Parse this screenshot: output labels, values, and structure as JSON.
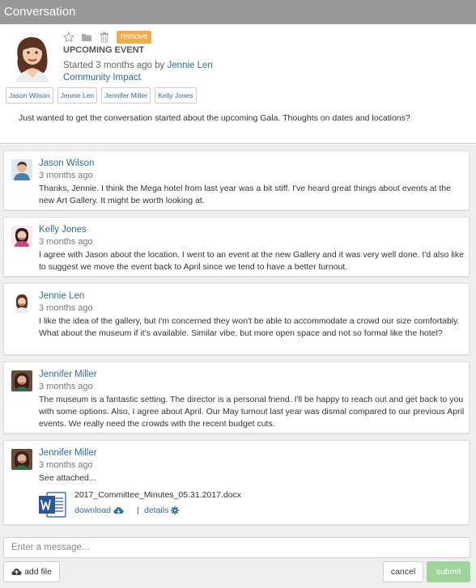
{
  "window": {
    "title": "Conversation"
  },
  "header": {
    "remove_label": "remove",
    "event_title": "UPCOMING EVENT",
    "started_text": "Started 3 months ago by",
    "started_by": "Jennie Len",
    "community": "Community Impact",
    "tags": [
      "Jason Wilson",
      "Jennie Len",
      "Jennifer Miller",
      "Kelly Jones"
    ],
    "intro": "Just wanted to get the conversation started about the upcoming Gala. Thoughts on dates and locations?"
  },
  "messages": [
    {
      "author": "Jason Wilson",
      "time": "3 months ago",
      "text": "Thanks, Jennie. I think the Mega hotel from last year was a bit stiff. I've heard great things about events at the new Art Gallery. It might be worth looking at."
    },
    {
      "author": "Kelly Jones",
      "time": "3 months ago",
      "text": "I agree with Jason about the location. I went to an event at the new Gallery and it was very well done. I'd also like to suggest we move the event back to April since we tend to have a better turnout."
    },
    {
      "author": "Jennie Len",
      "time": "3 months ago",
      "text": "I like the idea of the gallery, but I'm concerned they won't be able to accommodate a crowd our size comfortably. What about the museum if it's available. Similar vibe, but more open space and not so formal like the hotel?"
    },
    {
      "author": "Jennifer Miller",
      "time": "3 months ago",
      "text": "The museum is a fantastic setting. The director is a personal friend. I'll be happy to reach out and get back to you with some options. Also, I agree about April. Our May turnout last year was dismal compared to our previous April events. We really need the crowds with the recent budget cuts."
    },
    {
      "author": "Jennifer Miller",
      "time": "3 months ago",
      "text": "See attached...",
      "attachment": {
        "filename": "2017_Committee_Minutes_05.31.2017.docx",
        "download_label": "download",
        "separator": "|",
        "details_label": "details"
      }
    }
  ],
  "composer": {
    "placeholder": "Enter a message...",
    "add_file_label": "add file",
    "cancel_label": "cancel",
    "submit_label": "submit"
  },
  "colors": {
    "titlebar": "#999999",
    "link": "#2e6da4",
    "remove": "#f0ad4e",
    "submit": "#9ed49a",
    "thread_bg": "#efefef"
  },
  "icons": [
    "star-icon",
    "folder-icon",
    "trash-icon",
    "word-doc-icon",
    "cloud-download-icon",
    "gear-icon",
    "cloud-upload-icon"
  ]
}
